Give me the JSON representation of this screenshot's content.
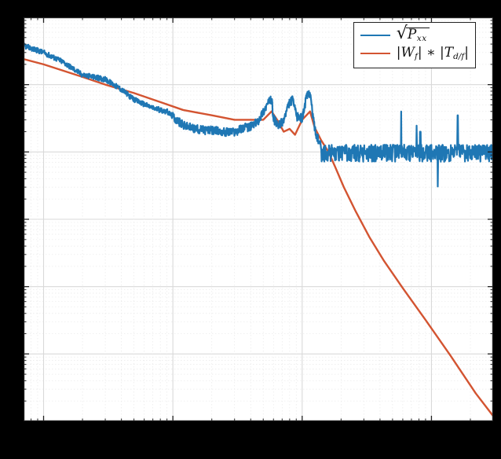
{
  "chart_data": {
    "type": "line",
    "xscale": "log",
    "yscale": "log",
    "xlim": [
      0.7,
      3000
    ],
    "ylim": [
      1e-06,
      1
    ],
    "title": "",
    "xlabel": "",
    "ylabel": "",
    "grid": true,
    "legend_position": "upper right",
    "series": [
      {
        "name": "sqrt(P_xx)",
        "color": "#1f77b4",
        "x": [
          0.7,
          1,
          1.4,
          2,
          3,
          4,
          5,
          7,
          9,
          12,
          15,
          20,
          25,
          30,
          35,
          40,
          45,
          50,
          55,
          58,
          60,
          65,
          72,
          80,
          85,
          90,
          100,
          108,
          115,
          120,
          128,
          140,
          150,
          160,
          180,
          200,
          260,
          400,
          700,
          1200,
          1600,
          2000,
          2600,
          3000
        ],
        "y": [
          0.38,
          0.3,
          0.22,
          0.14,
          0.12,
          0.085,
          0.06,
          0.045,
          0.04,
          0.025,
          0.022,
          0.021,
          0.02,
          0.02,
          0.023,
          0.024,
          0.028,
          0.04,
          0.055,
          0.06,
          0.032,
          0.024,
          0.03,
          0.055,
          0.06,
          0.034,
          0.032,
          0.065,
          0.08,
          0.038,
          0.018,
          0.012,
          0.01,
          0.012,
          0.01,
          0.0095,
          0.009,
          0.0095,
          0.009,
          0.0095,
          0.0095,
          0.0095,
          0.0095,
          0.0095
        ],
        "spikes_x": [
          820,
          1600
        ],
        "spikes_y": [
          0.02,
          0.035
        ]
      },
      {
        "name": "|W_f| * |T_{d/f}|",
        "color": "#d35431",
        "x": [
          0.7,
          1,
          2,
          3,
          5,
          8,
          12,
          20,
          30,
          40,
          50,
          58,
          64,
          72,
          80,
          88,
          100,
          115,
          125,
          140,
          160,
          180,
          210,
          260,
          330,
          430,
          600,
          900,
          1400,
          2200,
          3000
        ],
        "y": [
          0.24,
          0.2,
          0.13,
          0.1,
          0.075,
          0.055,
          0.042,
          0.035,
          0.03,
          0.03,
          0.03,
          0.04,
          0.03,
          0.02,
          0.022,
          0.018,
          0.03,
          0.04,
          0.023,
          0.015,
          0.01,
          0.006,
          0.003,
          0.0013,
          0.00055,
          0.00024,
          9.5e-05,
          3.2e-05,
          9.5e-06,
          2.6e-06,
          1.2e-06
        ]
      }
    ],
    "y_gridlines_major": [
      1e-06,
      1e-05,
      0.0001,
      0.001,
      0.01,
      0.1,
      1
    ],
    "x_gridlines_major": [
      1,
      10,
      100,
      1000
    ]
  },
  "legend": {
    "items": [
      {
        "color": "#1f77b4",
        "label_html": "sqrtPxx"
      },
      {
        "color": "#d35431",
        "label_html": "WfTdf"
      }
    ]
  }
}
